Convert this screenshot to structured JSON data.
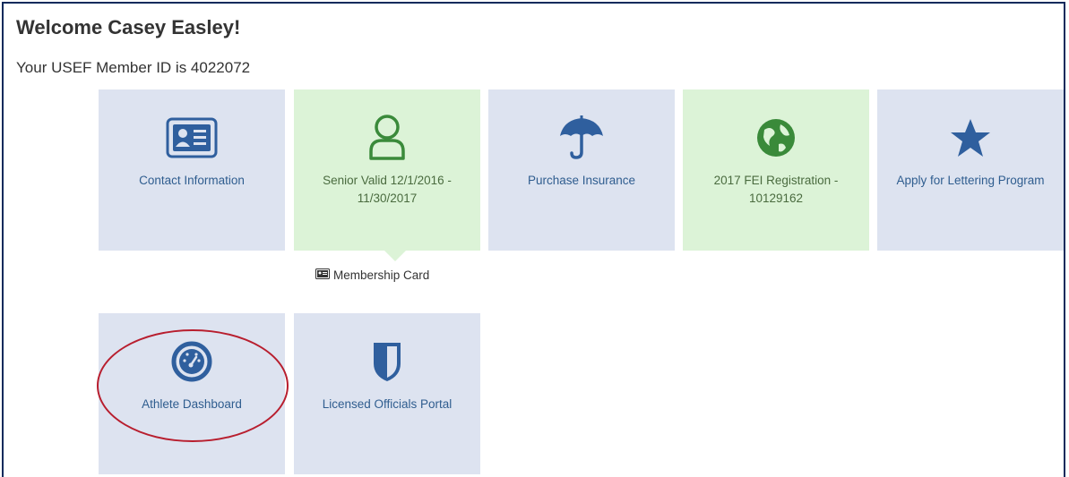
{
  "header": {
    "welcome": "Welcome Casey Easley!",
    "member_id_text": "Your USEF Member ID is 4022072"
  },
  "tiles": [
    {
      "label": "Contact Information",
      "icon": "contact-card-icon",
      "theme": "blue"
    },
    {
      "label": "Senior Valid 12/1/2016 - 11/30/2017",
      "icon": "person-icon",
      "theme": "green"
    },
    {
      "label": "Purchase Insurance",
      "icon": "umbrella-icon",
      "theme": "blue"
    },
    {
      "label": "2017 FEI Registration - 10129162",
      "icon": "globe-icon",
      "theme": "green"
    },
    {
      "label": "Apply for Lettering Program",
      "icon": "star-icon",
      "theme": "blue"
    },
    {
      "label": "Athlete Dashboard",
      "icon": "dashboard-gauge-icon",
      "theme": "blue"
    },
    {
      "label": "Licensed Officials Portal",
      "icon": "shield-icon",
      "theme": "blue"
    }
  ],
  "membership_card": {
    "label": "Membership Card",
    "icon": "id-card-small-icon"
  },
  "colors": {
    "tile_blue": "#dde3f0",
    "tile_green": "#dcf3d7",
    "icon_blue": "#2f5f9e",
    "icon_green": "#3a8a3a",
    "annotation_red": "#b81e2e",
    "frame_navy": "#0b2a5c"
  }
}
